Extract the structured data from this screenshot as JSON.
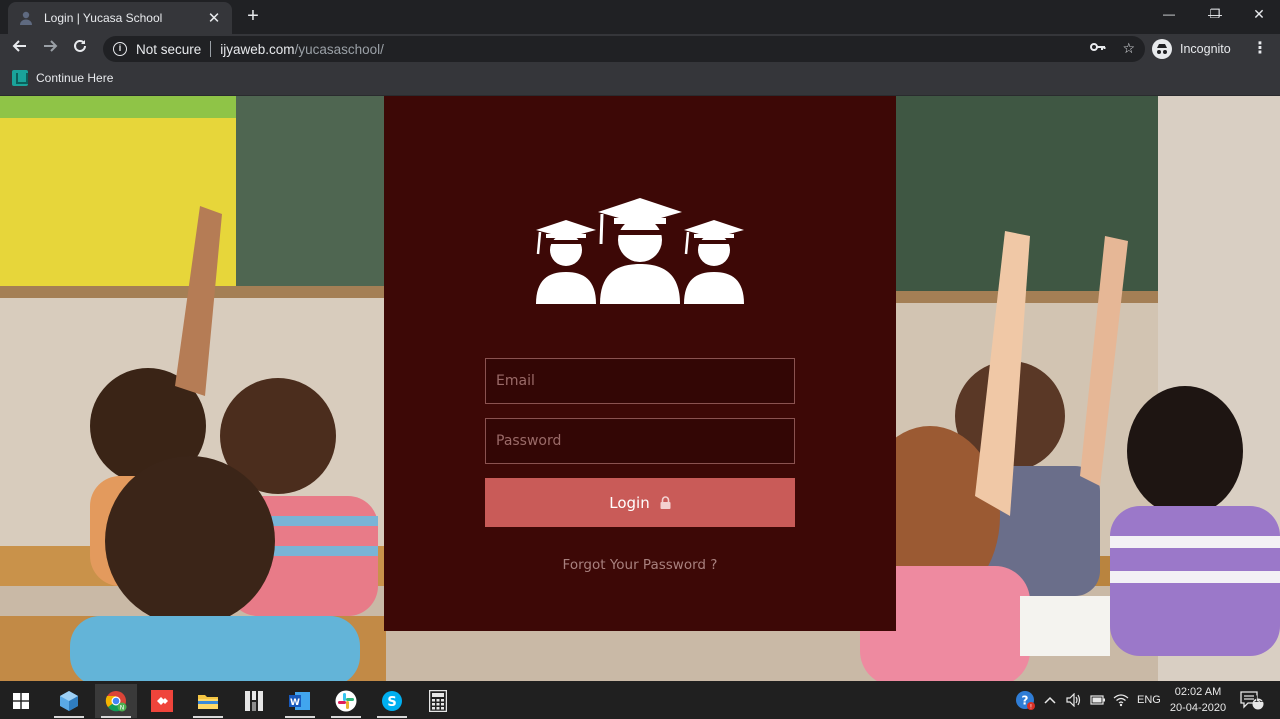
{
  "browser": {
    "tab_title": "Login | Yucasa School",
    "tab_close": "✕",
    "new_tab": "+",
    "security_label": "Not secure",
    "url_host": "ijyaweb.com",
    "url_path": "/yucasaschool/",
    "profile_label": "Incognito",
    "bookmark_label": "Continue Here",
    "window_controls": {
      "minimize": "—",
      "maximize": "❐",
      "close": "✕"
    }
  },
  "login": {
    "email_placeholder": "Email",
    "password_placeholder": "Password",
    "login_button_label": "Login",
    "forgot_link": "Forgot Your Password ?",
    "card_color": "#3d0806",
    "button_color": "#c95b58"
  },
  "taskbar": {
    "language": "ENG",
    "time": "02:02 AM",
    "date": "20-04-2020",
    "notification_count": "13",
    "apps": [
      "start-icon",
      "3d-viewer-icon",
      "chrome-icon",
      "anydesk-icon",
      "file-explorer-icon",
      "media-app-icon",
      "word-icon",
      "slack-icon",
      "skype-icon",
      "calculator-icon"
    ]
  }
}
